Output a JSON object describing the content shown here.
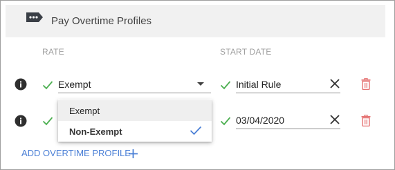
{
  "header": {
    "title": "Pay Overtime Profiles",
    "icon": "message-dots-icon"
  },
  "columns": {
    "rate": "RATE",
    "start_date": "START DATE"
  },
  "rows": [
    {
      "rate": "Exempt",
      "start_date": "Initial Rule"
    },
    {
      "rate": "",
      "start_date": "03/04/2020"
    }
  ],
  "dropdown": {
    "options": [
      "Exempt",
      "Non-Exempt"
    ],
    "selected": "Non-Exempt",
    "highlighted": "Exempt"
  },
  "add_button": {
    "label": "ADD OVERTIME PROFILE"
  },
  "colors": {
    "accent": "#4a7fd6",
    "check": "#4caf50",
    "delete": "#e57373",
    "header_bg": "#f1f1f1"
  }
}
